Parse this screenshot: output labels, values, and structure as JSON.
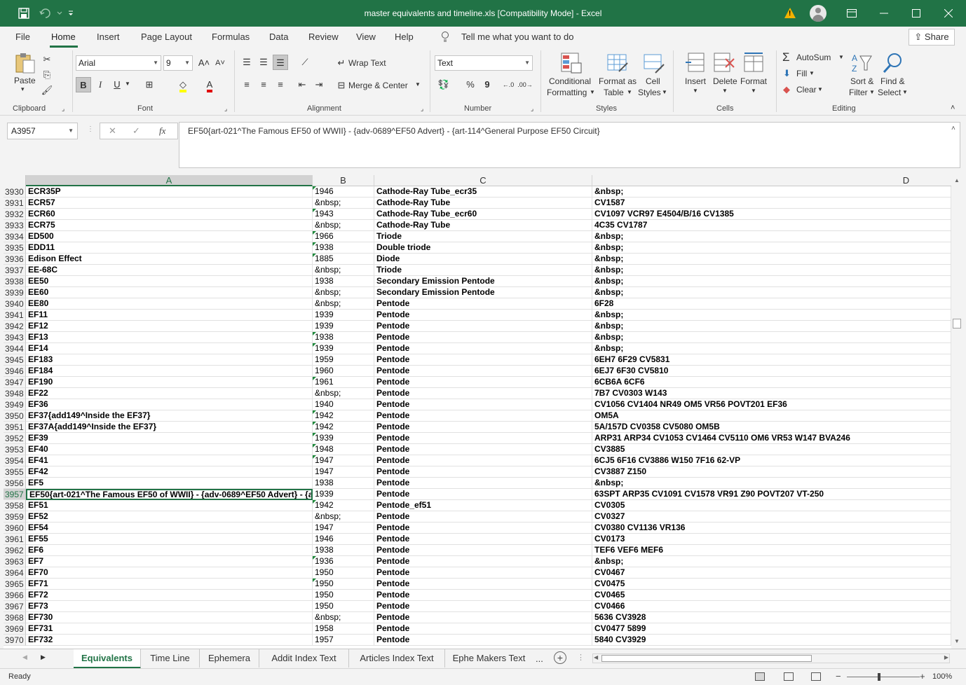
{
  "window": {
    "title": "master equivalents and timeline.xls  [Compatibility Mode]  -  Excel"
  },
  "ribbon_tabs": [
    "File",
    "Home",
    "Insert",
    "Page Layout",
    "Formulas",
    "Data",
    "Review",
    "View",
    "Help"
  ],
  "tell_me": "Tell me what you want to do",
  "share_label": "Share",
  "ribbon": {
    "clipboard": {
      "paste": "Paste",
      "label": "Clipboard"
    },
    "font": {
      "family": "Arial",
      "size": "9",
      "bold": "B",
      "italic": "I",
      "underline": "U",
      "label": "Font"
    },
    "alignment": {
      "wrap": "Wrap Text",
      "merge": "Merge & Center",
      "label": "Alignment"
    },
    "number": {
      "format": "Text",
      "percent": "%",
      "comma": "9",
      "label": "Number"
    },
    "styles": {
      "conditional_1": "Conditional",
      "conditional_2": "Formatting",
      "format_table_1": "Format as",
      "format_table_2": "Table",
      "cell_styles_1": "Cell",
      "cell_styles_2": "Styles",
      "label": "Styles"
    },
    "cells": {
      "insert": "Insert",
      "delete": "Delete",
      "format": "Format",
      "label": "Cells"
    },
    "editing": {
      "autosum": "AutoSum",
      "fill": "Fill",
      "clear": "Clear",
      "sort_1": "Sort &",
      "sort_2": "Filter",
      "find_1": "Find &",
      "find_2": "Select",
      "label": "Editing"
    }
  },
  "formula_bar": {
    "name_box": "A3957",
    "fx": "fx",
    "formula": "EF50{art-021^The Famous EF50 of WWII} - {adv-0689^EF50 Advert} - {art-114^General Purpose EF50 Circuit}"
  },
  "columns": [
    "A",
    "B",
    "C",
    "D"
  ],
  "rows": [
    {
      "n": "3930",
      "a": "ECR35P",
      "b": "1946",
      "c": "Cathode-Ray Tube_ecr35",
      "d": "&nbsp;",
      "flag": true
    },
    {
      "n": "3931",
      "a": "ECR57",
      "b": "&nbsp;",
      "c": "Cathode-Ray Tube",
      "d": "CV1587",
      "flag": false
    },
    {
      "n": "3932",
      "a": "ECR60",
      "b": "1943",
      "c": "Cathode-Ray Tube_ecr60",
      "d": "CV1097 VCR97 E4504/B/16 CV1385",
      "flag": true
    },
    {
      "n": "3933",
      "a": "ECR75",
      "b": "&nbsp;",
      "c": "Cathode-Ray Tube",
      "d": "4C35 CV1787",
      "flag": false
    },
    {
      "n": "3934",
      "a": "ED500",
      "b": "1966",
      "c": "Triode",
      "d": "&nbsp;",
      "flag": true
    },
    {
      "n": "3935",
      "a": "EDD11",
      "b": "1938",
      "c": "Double triode",
      "d": "&nbsp;",
      "flag": true
    },
    {
      "n": "3936",
      "a": "Edison Effect",
      "b": "1885",
      "c": "Diode",
      "d": "&nbsp;",
      "flag": true
    },
    {
      "n": "3937",
      "a": "EE-68C",
      "b": "&nbsp;",
      "c": "Triode",
      "d": "&nbsp;",
      "flag": false
    },
    {
      "n": "3938",
      "a": "EE50",
      "b": "1938",
      "c": "Secondary Emission Pentode",
      "d": "&nbsp;",
      "flag": false
    },
    {
      "n": "3939",
      "a": "EE60",
      "b": "&nbsp;",
      "c": "Secondary Emission Pentode",
      "d": "&nbsp;",
      "flag": false
    },
    {
      "n": "3940",
      "a": "EE80",
      "b": "&nbsp;",
      "c": "Pentode",
      "d": "6F28",
      "flag": false
    },
    {
      "n": "3941",
      "a": "EF11",
      "b": "1939",
      "c": "Pentode",
      "d": "&nbsp;",
      "flag": false
    },
    {
      "n": "3942",
      "a": "EF12",
      "b": "1939",
      "c": "Pentode",
      "d": "&nbsp;",
      "flag": false
    },
    {
      "n": "3943",
      "a": "EF13",
      "b": "1938",
      "c": "Pentode",
      "d": "&nbsp;",
      "flag": true
    },
    {
      "n": "3944",
      "a": "EF14",
      "b": "1939",
      "c": "Pentode",
      "d": "&nbsp;",
      "flag": true
    },
    {
      "n": "3945",
      "a": "EF183",
      "b": "1959",
      "c": "Pentode",
      "d": "6EH7 6F29 CV5831",
      "flag": false
    },
    {
      "n": "3946",
      "a": "EF184",
      "b": "1960",
      "c": "Pentode",
      "d": "6EJ7 6F30 CV5810",
      "flag": false
    },
    {
      "n": "3947",
      "a": "EF190",
      "b": "1961",
      "c": "Pentode",
      "d": "6CB6A 6CF6",
      "flag": true
    },
    {
      "n": "3948",
      "a": "EF22",
      "b": "&nbsp;",
      "c": "Pentode",
      "d": "7B7 CV0303 W143",
      "flag": false
    },
    {
      "n": "3949",
      "a": "EF36",
      "b": "1940",
      "c": "Pentode",
      "d": "CV1056 CV1404 NR49 OM5 VR56 POVT201 EF36",
      "flag": false
    },
    {
      "n": "3950",
      "a": "EF37{add149^Inside the EF37}",
      "b": "1942",
      "c": "Pentode",
      "d": "OM5A",
      "flag": true
    },
    {
      "n": "3951",
      "a": "EF37A{add149^Inside the EF37}",
      "b": "1942",
      "c": "Pentode",
      "d": "5A/157D CV0358 CV5080 OM5B",
      "flag": true
    },
    {
      "n": "3952",
      "a": "EF39",
      "b": "1939",
      "c": "Pentode",
      "d": "ARP31 ARP34 CV1053 CV1464 CV5110 OM6 VR53 W147 BVA246",
      "flag": true
    },
    {
      "n": "3953",
      "a": "EF40",
      "b": "1948",
      "c": "Pentode",
      "d": "CV3885",
      "flag": true
    },
    {
      "n": "3954",
      "a": "EF41",
      "b": "1947",
      "c": "Pentode",
      "d": "6CJ5 6F16 CV3886 W150 7F16 62-VP",
      "flag": true
    },
    {
      "n": "3955",
      "a": "EF42",
      "b": "1947",
      "c": "Pentode",
      "d": "CV3887 Z150",
      "flag": false
    },
    {
      "n": "3956",
      "a": "EF5",
      "b": "1938",
      "c": "Pentode",
      "d": "&nbsp;",
      "flag": false
    },
    {
      "n": "3957",
      "a": "EF50{art-021^The Famous EF50 of WWII} - {adv-0689^EF50 Advert} - {ar",
      "b": "1939",
      "c": "Pentode",
      "d": "63SPT ARP35 CV1091 CV1578 VR91 Z90 POVT207 VT-250",
      "flag": false,
      "active": true
    },
    {
      "n": "3958",
      "a": "EF51",
      "b": "1942",
      "c": "Pentode_ef51",
      "d": "CV0305",
      "flag": true
    },
    {
      "n": "3959",
      "a": "EF52",
      "b": "&nbsp;",
      "c": "Pentode",
      "d": "CV0327",
      "flag": false
    },
    {
      "n": "3960",
      "a": "EF54",
      "b": "1947",
      "c": "Pentode",
      "d": "CV0380 CV1136 VR136",
      "flag": false
    },
    {
      "n": "3961",
      "a": "EF55",
      "b": "1946",
      "c": "Pentode",
      "d": "CV0173",
      "flag": false
    },
    {
      "n": "3962",
      "a": "EF6",
      "b": "1938",
      "c": "Pentode",
      "d": "TEF6 VEF6 MEF6",
      "flag": false
    },
    {
      "n": "3963",
      "a": "EF7",
      "b": "1936",
      "c": "Pentode",
      "d": "&nbsp;",
      "flag": true
    },
    {
      "n": "3964",
      "a": "EF70",
      "b": "1950",
      "c": "Pentode",
      "d": "CV0467",
      "flag": false
    },
    {
      "n": "3965",
      "a": "EF71",
      "b": "1950",
      "c": "Pentode",
      "d": "CV0475",
      "flag": true
    },
    {
      "n": "3966",
      "a": "EF72",
      "b": "1950",
      "c": "Pentode",
      "d": "CV0465",
      "flag": false
    },
    {
      "n": "3967",
      "a": "EF73",
      "b": "1950",
      "c": "Pentode",
      "d": "CV0466",
      "flag": false
    },
    {
      "n": "3968",
      "a": "EF730",
      "b": "&nbsp;",
      "c": "Pentode",
      "d": "5636 CV3928",
      "flag": false
    },
    {
      "n": "3969",
      "a": "EF731",
      "b": "1958",
      "c": "Pentode",
      "d": "CV0477 5899",
      "flag": false
    },
    {
      "n": "3970",
      "a": "EF732",
      "b": "1957",
      "c": "Pentode",
      "d": "5840 CV3929",
      "flag": false
    }
  ],
  "sheets": [
    "Equivalents",
    "Time Line",
    "Ephemera",
    "Addit Index Text",
    "Articles Index Text",
    "Ephe Makers Text"
  ],
  "sheets_more": "...",
  "status": "Ready",
  "zoom": "100%",
  "colors": {
    "accent": "#217346",
    "flag": "#1e8a3c",
    "warning": "#f2b200"
  },
  "icons": [
    "save-icon",
    "undo-icon",
    "redo-icon",
    "customize-icon",
    "warning-icon",
    "user-icon",
    "ribbon-display-icon",
    "minimize-icon",
    "maximize-icon",
    "close-icon",
    "lightbulb-icon"
  ]
}
